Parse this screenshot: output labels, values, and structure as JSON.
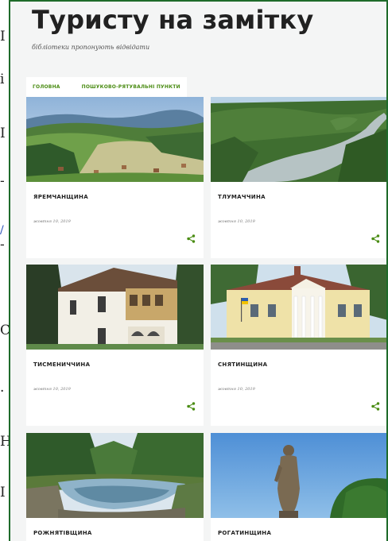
{
  "left_strip": [
    "І",
    "і",
    "І",
    "-",
    "/",
    "-",
    "С",
    "·",
    "Н",
    "І"
  ],
  "header": {
    "title": "Туристу на замітку",
    "description": "бібліотеки пропонують відвідати"
  },
  "nav": {
    "items": [
      "Головна",
      "Пошуково-рятувальні пункти"
    ]
  },
  "posts": [
    {
      "title": "Яремчанщина",
      "date": "жовтня 10, 2019"
    },
    {
      "title": "Тлумаччина",
      "date": "жовтня 10, 2019"
    },
    {
      "title": "Тисмениччина",
      "date": "жовтня 10, 2019"
    },
    {
      "title": "Снятинщина",
      "date": "жовтня 10, 2019"
    },
    {
      "title": "Рожнятівщина"
    },
    {
      "title": "Рогатинщина"
    }
  ],
  "colors": {
    "accent": "#4a8c13",
    "frame": "#1e6b2a",
    "background": "#f4f5f5"
  },
  "icons": {
    "share": "share-icon"
  }
}
